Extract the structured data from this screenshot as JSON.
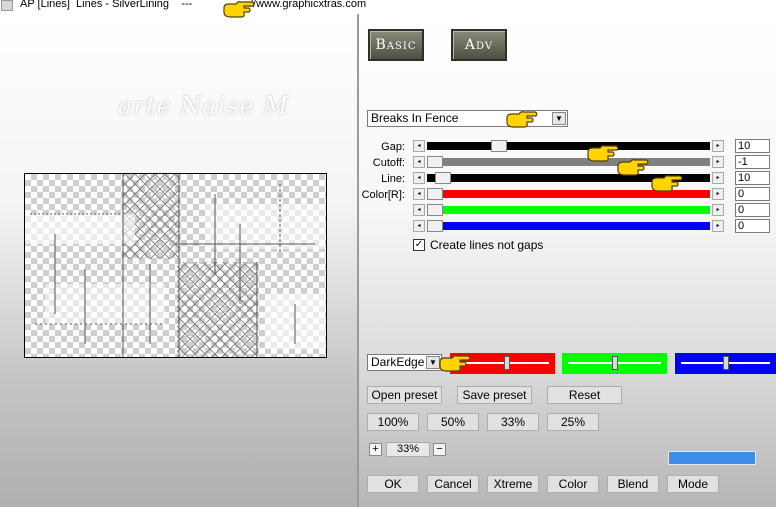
{
  "window": {
    "title": "AP [Lines]  Lines - SilverLining    ---",
    "url_text": "//www.graphicxtras.com"
  },
  "watermark": "arte Naise M",
  "tabs": {
    "basic": "Basic",
    "adv": "Adv"
  },
  "effect_dropdown": {
    "value": "Breaks In Fence"
  },
  "sliders": [
    {
      "label": "Gap:",
      "value": "10",
      "track_color": "#000000",
      "level": 0.24
    },
    {
      "label": "Cutoff:",
      "value": "-1",
      "track_color": "#808080",
      "level": 0.0
    },
    {
      "label": "Line:",
      "value": "10",
      "track_color": "#000000",
      "level": 0.03
    },
    {
      "label": "Color[R]:",
      "value": "0",
      "track_color": "#ff0000",
      "level": 0.0
    },
    {
      "label": "",
      "value": "0",
      "track_color": "#00ff00",
      "level": 0.0
    },
    {
      "label": "",
      "value": "0",
      "track_color": "#0000ff",
      "level": 0.0
    }
  ],
  "checkbox": {
    "label": "Create lines not gaps",
    "checked": true,
    "mark": "✓"
  },
  "blend_dropdown": {
    "value": "DarkEdge"
  },
  "color_sliders": [
    {
      "color": "#ff0000",
      "level": 0.55
    },
    {
      "color": "#00ff00",
      "level": 0.5
    },
    {
      "color": "#0000ff",
      "level": 0.5
    }
  ],
  "preset_buttons": {
    "open": "Open preset",
    "save": "Save preset",
    "reset": "Reset"
  },
  "zoom_buttons": [
    "100%",
    "50%",
    "33%",
    "25%"
  ],
  "zoom": {
    "plus": "+",
    "value": "33%",
    "minus": "−"
  },
  "swatch_color": "#3b8de6",
  "footer_buttons": {
    "ok": "OK",
    "cancel": "Cancel",
    "xtreme": "Xtreme",
    "color": "Color",
    "blend": "Blend",
    "mode": "Mode"
  },
  "icons": {
    "pointer": "pointing-hand-icon",
    "arrow_left": "◂",
    "arrow_right": "▸",
    "arrow_down": "▼"
  }
}
